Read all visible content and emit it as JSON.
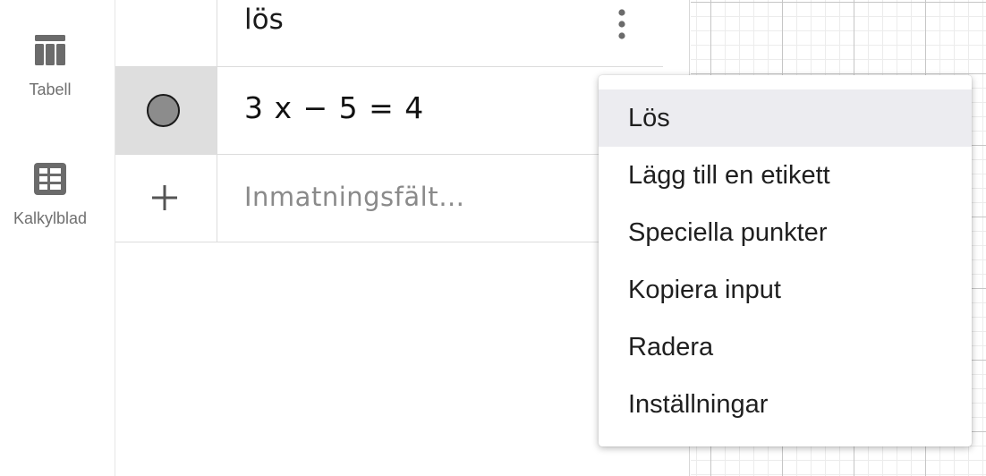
{
  "sidebar": {
    "tabell_label": "Tabell",
    "kalkylblad_label": "Kalkylblad"
  },
  "algebra": {
    "row1_text": "lös",
    "row2_expression": "3 x − 5 = 4",
    "input_placeholder": "Inmatningsfält…"
  },
  "context_menu": {
    "items": [
      {
        "label": "Lös"
      },
      {
        "label": "Lägg till en etikett"
      },
      {
        "label": "Speciella punkter"
      },
      {
        "label": "Kopiera input"
      },
      {
        "label": "Radera"
      },
      {
        "label": "Inställningar"
      }
    ],
    "highlighted_index": 0
  },
  "colors": {
    "marble_fill": "#8c8c8c",
    "selected_row_bg": "#dedede",
    "menu_highlight": "#ececf0",
    "grid_major": "#c6c6c6",
    "grid_minor": "#ececec"
  },
  "icons": {
    "tabell": "table-icon",
    "kalkylblad": "spreadsheet-icon",
    "more": "more-vertical-icon",
    "add": "plus-icon",
    "visibility": "visibility-marble-icon"
  }
}
